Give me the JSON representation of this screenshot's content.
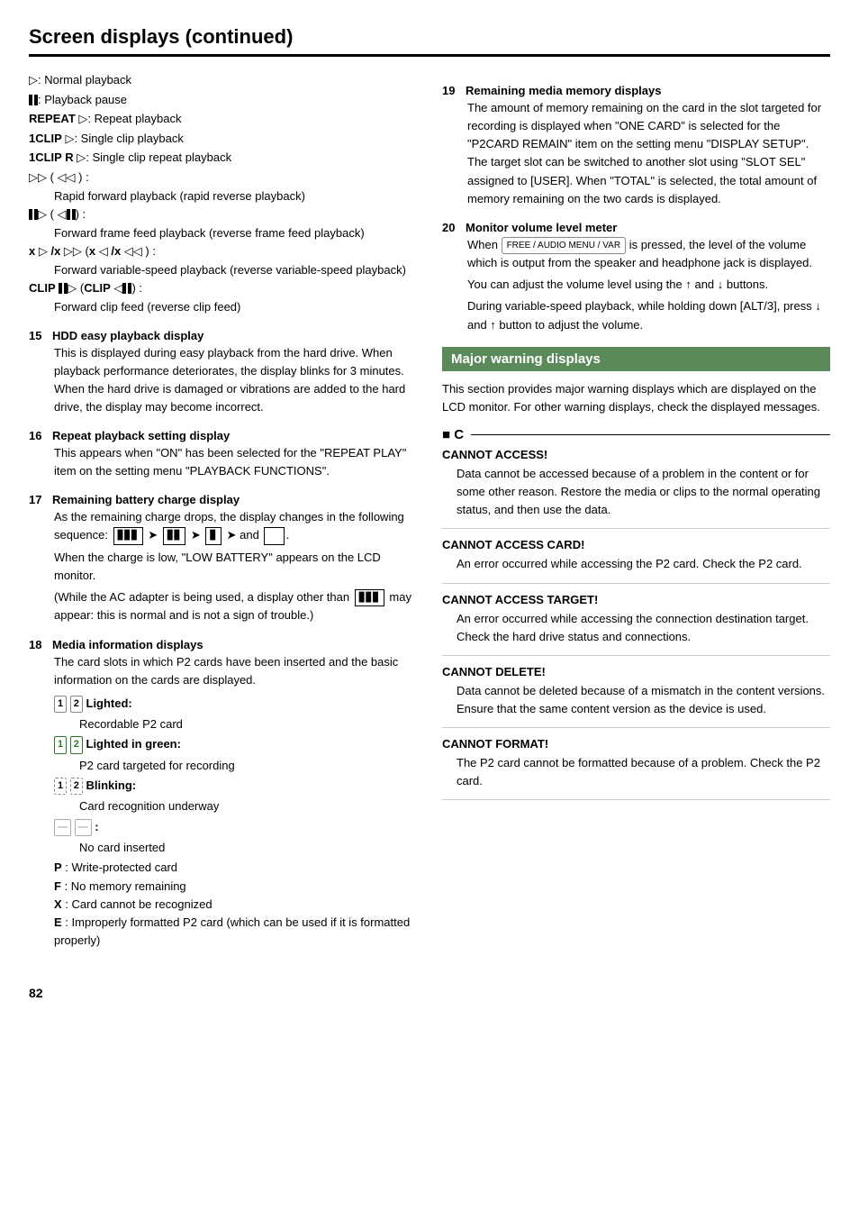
{
  "page": {
    "title": "Screen displays (continued)",
    "page_number": "82"
  },
  "left_column": {
    "intro_items": [
      {
        "id": "play_normal",
        "symbol": "▷",
        "label": ": Normal playback"
      },
      {
        "id": "play_pause",
        "symbol": "⏸",
        "label": ": Playback pause"
      },
      {
        "id": "repeat",
        "symbol": "REPEAT ▷",
        "label": ": Repeat playback"
      },
      {
        "id": "1clip",
        "symbol": "1CLIP ▷",
        "label": ": Single clip playback"
      },
      {
        "id": "1clip_r",
        "symbol": "1CLIP R ▷",
        "label": ": Single clip repeat playback"
      },
      {
        "id": "ff_rev",
        "symbol": "▷▷ ( ◁◁ ) :",
        "label": ""
      },
      {
        "id": "ff_rev_desc",
        "text": "Rapid forward playback (rapid reverse playback)"
      },
      {
        "id": "frame_fwd",
        "symbol": "⏸▷ ( ◁⏸) :",
        "label": ""
      },
      {
        "id": "frame_fwd_desc",
        "text": "Forward frame feed playback (reverse frame feed playback)"
      },
      {
        "id": "varspeed",
        "symbol": "x ▷ /x ▷▷ (x ◁ /x ◁◁ ) :",
        "label": ""
      },
      {
        "id": "varspeed_desc",
        "text": "Forward variable-speed playback (reverse variable-speed playback)"
      },
      {
        "id": "clip_feed",
        "symbol": "CLIP ⏸▷ (CLIP ◁⏸) :",
        "label": ""
      },
      {
        "id": "clip_feed_desc",
        "text": "Forward clip feed (reverse clip feed)"
      }
    ],
    "sections": [
      {
        "num": "15",
        "title": "HDD easy playback display",
        "body": "This is displayed during easy playback from the hard drive. When playback performance deteriorates, the display blinks for 3 minutes. When the hard drive is damaged or vibrations are added to the hard drive, the display may become incorrect."
      },
      {
        "num": "16",
        "title": "Repeat playback setting display",
        "body": "This appears when \"ON\" has been selected for the \"REPEAT PLAY\" item on the setting menu \"PLAYBACK FUNCTIONS\"."
      },
      {
        "num": "17",
        "title": "Remaining battery charge display",
        "body_parts": [
          {
            "type": "text",
            "text": "As the remaining charge drops, the display changes in the following sequence:"
          },
          {
            "type": "battery_row"
          },
          {
            "type": "text",
            "text": "When the charge is low, \"LOW BATTERY\" appears on the LCD monitor."
          },
          {
            "type": "text",
            "text": "(While the AC adapter is being used, a display other than "
          },
          {
            "type": "inline_icon",
            "text": "may appear: this is normal and is not a sign of trouble.)"
          }
        ]
      },
      {
        "num": "18",
        "title": "Media information displays",
        "body": "The card slots in which P2 cards have been inserted and the basic information on the cards are displayed.",
        "sub_items": [
          {
            "symbol": "1 2",
            "type": "normal",
            "label": "Lighted:",
            "desc": "Recordable P2 card"
          },
          {
            "symbol": "1 2",
            "type": "green",
            "label": "Lighted in green:",
            "desc": "P2 card targeted for recording"
          },
          {
            "symbol": "1 2",
            "type": "blink",
            "label": "Blinking:",
            "desc": "Card recognition underway"
          },
          {
            "symbol": "—|—|",
            "type": "dash",
            "label": ":",
            "desc": "No card inserted"
          },
          {
            "symbol": "P",
            "label": ": Write-protected card"
          },
          {
            "symbol": "F",
            "label": ": No memory remaining"
          },
          {
            "symbol": "X",
            "label": ": Card cannot be recognized"
          },
          {
            "symbol": "E",
            "label": ": Improperly formatted P2 card (which can be used if it is formatted properly)"
          }
        ]
      }
    ]
  },
  "right_column": {
    "sections": [
      {
        "num": "19",
        "title": "Remaining media memory displays",
        "body": "The amount of memory remaining on the card in the slot targeted for recording is displayed when \"ONE CARD\" is selected for the \"P2CARD REMAIN\" item on the setting menu \"DISPLAY SETUP\". The target slot can be switched to another slot using \"SLOT SEL\" assigned to [USER]. When \"TOTAL\" is selected, the total amount of memory remaining on the two cards is displayed."
      },
      {
        "num": "20",
        "title": "Monitor volume level meter",
        "body_parts": [
          {
            "type": "text",
            "text": "When"
          },
          {
            "type": "vol_icon",
            "text": "AUDIO MENU / VAR"
          },
          {
            "type": "text",
            "text": "is pressed, the level of the volume which is output from the speaker and headphone jack is displayed."
          },
          {
            "type": "text",
            "text": "You can adjust the volume level using the ↑ and ↓ buttons."
          },
          {
            "type": "text",
            "text": "During variable-speed playback, while holding down [ALT/3], press ↓ and ↑ button to adjust the volume."
          }
        ]
      }
    ],
    "warning_section": {
      "header": "Major warning displays",
      "intro": "This section provides major warning displays which are displayed on the LCD monitor. For other warning displays, check the displayed messages.",
      "c_label": "C",
      "items": [
        {
          "title": "CANNOT ACCESS!",
          "body": "Data cannot be accessed because of a problem in the content or for some other reason. Restore the media or clips to the normal operating status, and then use the data."
        },
        {
          "title": "CANNOT ACCESS CARD!",
          "body": "An error occurred while accessing the P2 card. Check the P2 card."
        },
        {
          "title": "CANNOT ACCESS TARGET!",
          "body": "An error occurred while accessing the connection destination target. Check the hard drive status and connections."
        },
        {
          "title": "CANNOT DELETE!",
          "body": "Data cannot be deleted because of a mismatch in the content versions. Ensure that the same content version as the device is used."
        },
        {
          "title": "CANNOT FORMAT!",
          "body": "The P2 card cannot be formatted because of a problem. Check the P2 card."
        }
      ]
    }
  }
}
